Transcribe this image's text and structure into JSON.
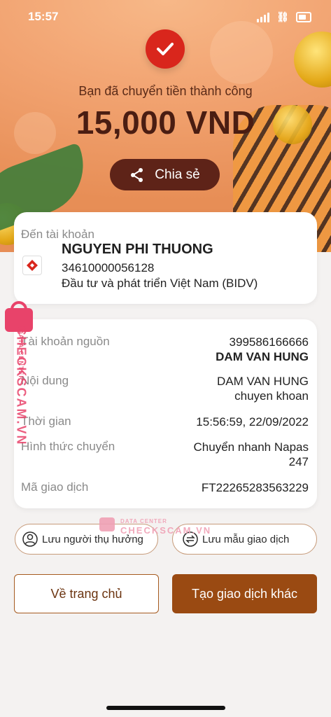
{
  "status_bar": {
    "time": "15:57"
  },
  "result": {
    "message": "Bạn đã chuyển tiền thành công",
    "amount": "15,000 VND",
    "share_label": "Chia sẻ"
  },
  "recipient": {
    "label": "Đến tài khoản",
    "name": "NGUYEN PHI THUONG",
    "account_number": "34610000056128",
    "bank_name": "Đầu tư và phát triển Việt Nam (BIDV)"
  },
  "details": {
    "source_label": "Tài khoản nguồn",
    "source_account": "399586166666",
    "source_name": "DAM VAN HUNG",
    "content_label": "Nội dung",
    "content_line1": "DAM VAN HUNG",
    "content_line2": "chuyen khoan",
    "time_label": "Thời gian",
    "time_value": "15:56:59, 22/09/2022",
    "method_label": "Hình thức chuyển",
    "method_line1": "Chuyển nhanh Napas",
    "method_line2": "247",
    "txn_label": "Mã giao dịch",
    "txn_value": "FT22265283563229"
  },
  "actions": {
    "save_recipient": "Lưu người thụ hưởng",
    "save_template": "Lưu mẫu giao dịch",
    "home": "Về trang chủ",
    "new_transaction": "Tạo giao dịch khác"
  },
  "watermark": {
    "side_text": "CHECKSCAM.VN",
    "side_sub": "DATA CENTER",
    "mid_sub": "DATA CENTER",
    "mid_text": "CHECKSCAM.VN"
  },
  "colors": {
    "accent_red": "#d9261c",
    "brand_brown": "#9a4a12",
    "share_bg": "#5e2318"
  }
}
